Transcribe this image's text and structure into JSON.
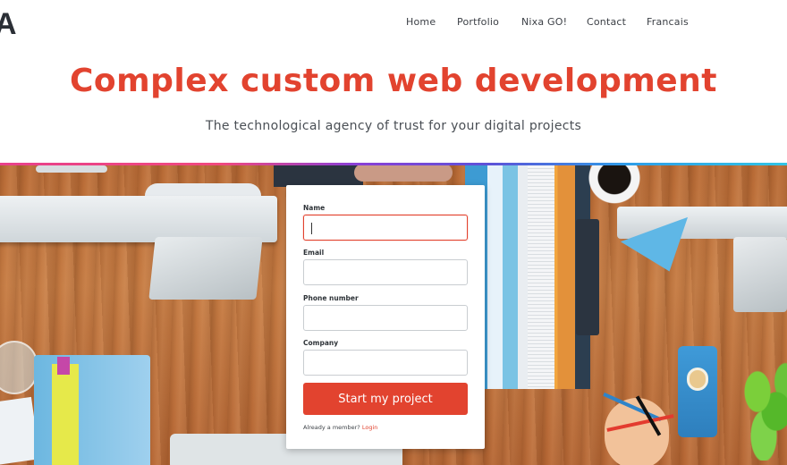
{
  "header": {
    "logo_fragment": "A",
    "nav": [
      {
        "label": "Home"
      },
      {
        "label": "Portfolio"
      },
      {
        "label": "Nixa GO!"
      },
      {
        "label": "Contact"
      },
      {
        "label": "Francais"
      }
    ]
  },
  "hero": {
    "title": "Complex custom web development",
    "subtitle": "The technological agency of trust for your digital projects"
  },
  "form": {
    "fields": [
      {
        "label": "Name",
        "value": "",
        "placeholder": ""
      },
      {
        "label": "Email",
        "value": "",
        "placeholder": ""
      },
      {
        "label": "Phone number",
        "value": "",
        "placeholder": ""
      },
      {
        "label": "Company",
        "value": "",
        "placeholder": ""
      }
    ],
    "submit_label": "Start my project",
    "member_text": "Already a member?",
    "login_label": "Login"
  },
  "colors": {
    "accent": "#e2432f",
    "strip_start": "#e8418b",
    "strip_end": "#31c4e6"
  }
}
